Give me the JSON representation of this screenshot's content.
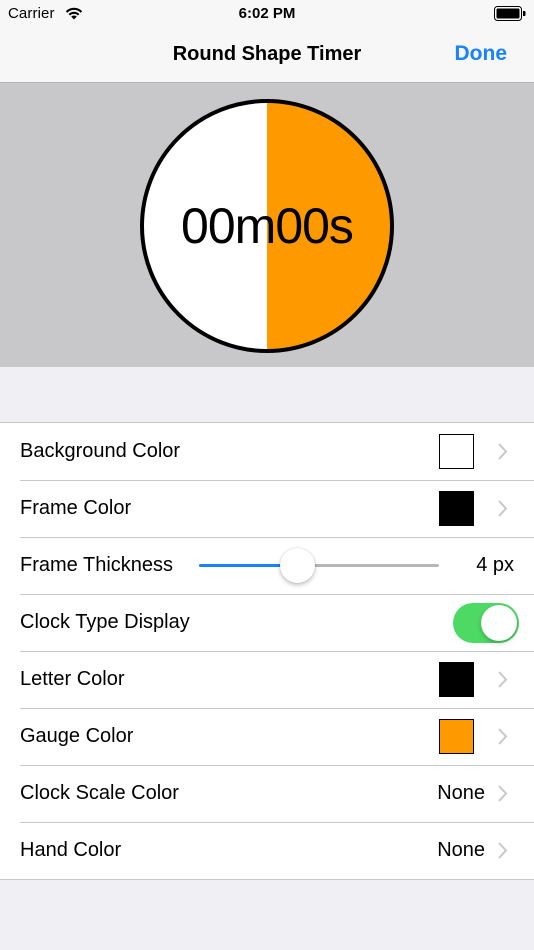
{
  "status_bar": {
    "carrier": "Carrier",
    "time": "6:02 PM",
    "wifi_icon": "wifi-icon",
    "battery_icon": "battery-icon"
  },
  "nav": {
    "title": "Round Shape Timer",
    "done_label": "Done"
  },
  "preview": {
    "timer_text": "00m00s",
    "gauge_fraction": 0.5,
    "background_color": "#ffffff",
    "frame_color": "#000000",
    "gauge_color": "#ff9900",
    "letter_color": "#000000"
  },
  "settings": {
    "background_color": {
      "label": "Background Color",
      "swatch": "#ffffff"
    },
    "frame_color": {
      "label": "Frame Color",
      "swatch": "#000000"
    },
    "frame_thickness": {
      "label": "Frame Thickness",
      "value_label": "4 px",
      "fraction": 0.41
    },
    "clock_type_display": {
      "label": "Clock Type Display",
      "on": true
    },
    "letter_color": {
      "label": "Letter Color",
      "swatch": "#000000"
    },
    "gauge_color": {
      "label": "Gauge Color",
      "swatch": "#ff9900"
    },
    "clock_scale_color": {
      "label": "Clock Scale Color",
      "value": "None"
    },
    "hand_color": {
      "label": "Hand Color",
      "value": "None"
    }
  },
  "colors": {
    "accent": "#1a82fb",
    "toggle_on": "#4cd964",
    "preview_bg": "#c8c8cb",
    "chevron": "#c7c7cc"
  }
}
